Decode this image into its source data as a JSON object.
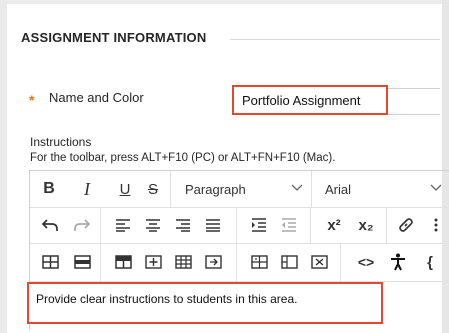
{
  "section": {
    "title": "ASSIGNMENT INFORMATION"
  },
  "name_field": {
    "label": "Name and Color",
    "required_marker": "*",
    "value": "Portfolio Assignment"
  },
  "instructions": {
    "label": "Instructions",
    "toolbar_hint": "For the toolbar, press ALT+F10 (PC) or ALT+FN+F10 (Mac).",
    "content": "Provide clear instructions to students in this area."
  },
  "toolbar": {
    "row1": {
      "bold": "B",
      "italic": "I",
      "underline": "U",
      "strikethrough": "S",
      "block_format": "Paragraph",
      "font_family": "Arial"
    },
    "row2": {
      "icons": [
        "undo-icon",
        "redo-icon",
        "align-left-icon",
        "align-center-icon",
        "align-right-icon",
        "justify-icon",
        "indent-icon",
        "outdent-icon",
        "superscript-icon",
        "subscript-icon",
        "link-icon"
      ],
      "superscript_label": "x²",
      "subscript_label": "x₂"
    },
    "row3": {
      "icons": [
        "table-icon",
        "table-row-icon",
        "table-header-icon",
        "insert-row-icon",
        "insert-column-icon",
        "merge-cells-icon",
        "table-props-icon",
        "split-cells-icon",
        "delete-cell-icon",
        "code-view-icon",
        "accessibility-icon"
      ],
      "code_label": "<>",
      "partial_label": "{"
    }
  },
  "colors": {
    "required": "#e8770c",
    "highlight_border": "#e8472f",
    "text": "#262626"
  }
}
